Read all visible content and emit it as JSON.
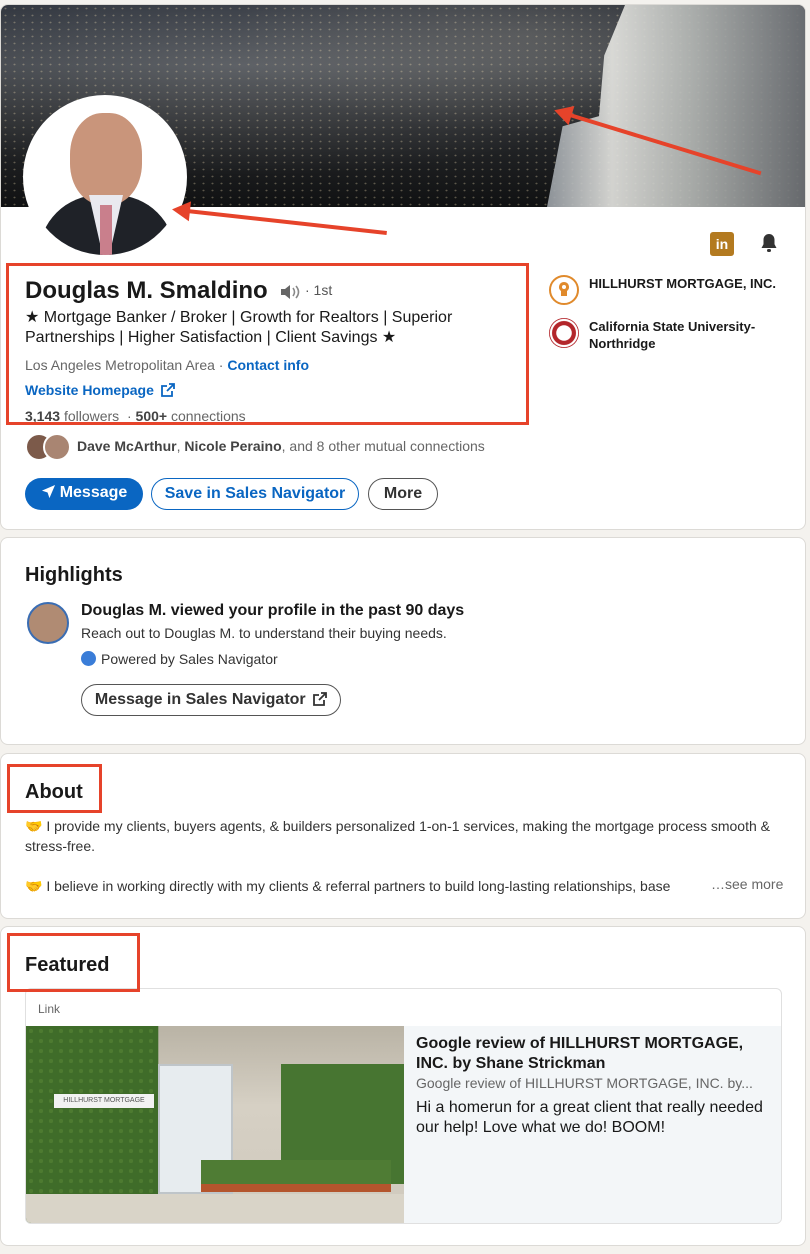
{
  "profile": {
    "name": "Douglas M. Smaldino",
    "degree": "· 1st",
    "headline": "★ Mortgage Banker / Broker | Growth for Realtors | Superior Partnerships | Higher Satisfaction | Client Savings ★",
    "location": "Los Angeles Metropolitan Area",
    "location_sep": " · ",
    "contact_info": "Contact info",
    "website": "Website Homepage",
    "followers": "3,143",
    "followers_label": "followers",
    "connections": "500+",
    "connections_label": "connections",
    "mutual_name_1": "Dave McArthur",
    "mutual_name_2": "Nicole Peraino",
    "mutual_rest": ", and 8 other mutual connections",
    "buttons": {
      "message": "Message",
      "save_nav": "Save in Sales Navigator",
      "more": "More"
    },
    "companies": [
      {
        "name": "HILLHURST MORTGAGE, INC.",
        "color": "#e08a2c"
      },
      {
        "name": "California State University-Northridge",
        "color": "#b3262b"
      }
    ],
    "linkedin_icon_text": "in"
  },
  "highlights": {
    "title": "Highlights",
    "item_title": "Douglas M. viewed your profile in the past 90 days",
    "item_sub": "Reach out to Douglas M. to understand their buying needs.",
    "powered": "Powered by Sales Navigator",
    "button": "Message in Sales Navigator"
  },
  "about": {
    "title": "About",
    "para_1": "🤝 I provide my clients, buyers agents, & builders personalized 1-on-1 services, making the mortgage process smooth & stress-free.",
    "para_2": "🤝 I believe in working directly with my clients & referral partners to build long-lasting relationships, base",
    "see_more": "…see more"
  },
  "featured": {
    "title": "Featured",
    "tag": "Link",
    "item_title": "Google review of HILLHURST MORTGAGE, INC. by Shane Strickman",
    "item_source": "Google review of HILLHURST MORTGAGE, INC. by...",
    "item_desc": "Hi a homerun for a great client that really needed our help! Love what we do! BOOM!",
    "image_sign": "HILLHURST MORTGAGE"
  },
  "colors": {
    "accent": "#0a66c2",
    "annotation": "#e6432a"
  }
}
